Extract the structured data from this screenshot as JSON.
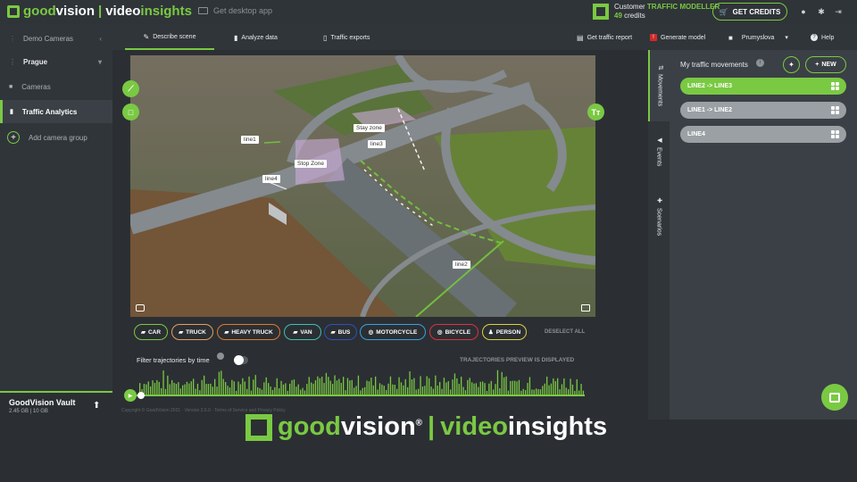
{
  "brand": {
    "good": "good",
    "vision": "vision",
    "separator": "|",
    "video": "video",
    "insights": "insights"
  },
  "topbar": {
    "desktop_app": "Get desktop app",
    "customer_label": "Customer",
    "customer_plan": "TRAFFIC MODELLER",
    "credits_count": "49",
    "credits_label": "credits",
    "get_credits": "GET CREDITS"
  },
  "sidebar": {
    "items": [
      {
        "label": "Demo Cameras"
      },
      {
        "label": "Prague"
      },
      {
        "label": "Cameras"
      },
      {
        "label": "Traffic Analytics"
      },
      {
        "label": "Add camera group"
      }
    ],
    "vault_title": "GoodVision Vault",
    "vault_size": "2.45 GB | 10 GB"
  },
  "tabs": [
    {
      "label": "Describe scene"
    },
    {
      "label": "Analyze data"
    },
    {
      "label": "Traffic exports"
    }
  ],
  "toolbar_right": {
    "report": "Get traffic report",
    "model": "Generate model",
    "camera": "Prumyslova",
    "help": "Help"
  },
  "video": {
    "labels": [
      "line1",
      "Stay zone",
      "line3",
      "Stop Zone",
      "line4",
      "line2"
    ],
    "text_tool": "Tт"
  },
  "classes": [
    {
      "label": "CAR",
      "color": "#7ac943"
    },
    {
      "label": "TRUCK",
      "color": "#e0a060"
    },
    {
      "label": "HEAVY TRUCK",
      "color": "#e07a30"
    },
    {
      "label": "VAN",
      "color": "#3fc0b0"
    },
    {
      "label": "BUS",
      "color": "#3050c0"
    },
    {
      "label": "MOTORCYCLE",
      "color": "#3aa0e0"
    },
    {
      "label": "BICYCLE",
      "color": "#e03040"
    },
    {
      "label": "PERSON",
      "color": "#e0d040"
    }
  ],
  "deselect_all": "DESELECT ALL",
  "filter": {
    "label": "Filter trajectories by time",
    "preview": "TRAJECTORIES PREVIEW IS DISPLAYED"
  },
  "footer_line": "Copyright © GoodVision 2021 · Version 2.6.0 · Terms of Service and Privacy Policy",
  "right_panel": {
    "vtabs": [
      {
        "label": "Movements"
      },
      {
        "label": "Events"
      },
      {
        "label": "Scenarios"
      }
    ],
    "title": "My traffic movements",
    "new_label": "NEW",
    "movements": [
      {
        "label": "LINE2 -> LINE3",
        "active": true
      },
      {
        "label": "LINE1 -> LINE2",
        "active": false
      },
      {
        "label": "LINE4",
        "active": false
      }
    ]
  },
  "accent": "#7ac943"
}
